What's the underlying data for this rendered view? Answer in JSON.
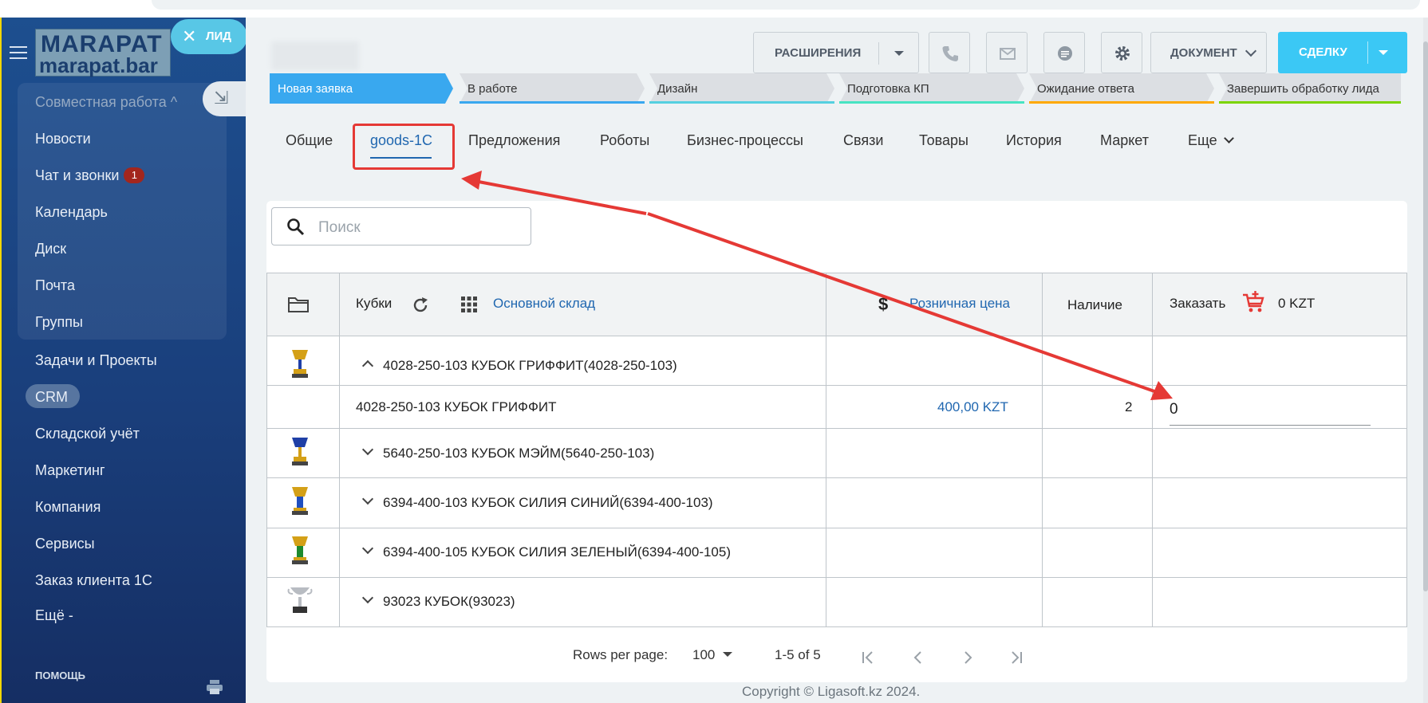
{
  "sidebar": {
    "logo_line1": "MARAPAT",
    "logo_line2": "marapat.bar",
    "lead_button": "ЛИД",
    "group_header": "Совместная работа ^",
    "items": [
      "Новости",
      "Чат и звонки",
      "Календарь",
      "Диск",
      "Почта",
      "Группы",
      "Задачи и Проекты",
      "CRM",
      "Складской учёт",
      "Маркетинг",
      "Компания",
      "Сервисы",
      "Заказ клиента 1С",
      "Ещё -"
    ],
    "chat_badge": "1",
    "help": "ПОМОЩЬ"
  },
  "toolbar": {
    "extensions_label": "РАСШИРЕНИЯ",
    "document_label": "ДОКУМЕНТ",
    "deal_label": "СДЕЛКУ"
  },
  "stages": [
    {
      "label": "Новая заявка",
      "color": "#2fc6f6",
      "active": true
    },
    {
      "label": "В работе",
      "color": "#39a8ef",
      "active": false
    },
    {
      "label": "Дизайн",
      "color": "#55d0e0",
      "active": false
    },
    {
      "label": "Подготовка КП",
      "color": "#47e4c2",
      "active": false
    },
    {
      "label": "Ожидание ответа",
      "color": "#ffa900",
      "active": false
    },
    {
      "label": "Завершить обработку лида",
      "color": "#7bd500",
      "active": false
    }
  ],
  "tabs": [
    "Общие",
    "goods-1C",
    "Предложения",
    "Роботы",
    "Бизнес-процессы",
    "Связи",
    "Товары",
    "История",
    "Маркет",
    "Еще"
  ],
  "search": {
    "placeholder": "Поиск"
  },
  "table": {
    "category": "Кубки",
    "warehouse": "Основной склад",
    "price_header": "Розничная цена",
    "stock_header": "Наличие",
    "order_header": "Заказать",
    "order_total": "0 KZT",
    "rows": [
      {
        "title": "4028-250-103 КУБОК ГРИФФИТ(4028-250-103)",
        "expanded": true,
        "cup_color": "#d4a017"
      },
      {
        "title": "5640-250-103 КУБОК МЭЙМ(5640-250-103)",
        "expanded": false,
        "cup_color": "#1f3fa6"
      },
      {
        "title": "6394-400-103 КУБОК СИЛИЯ СИНИЙ(6394-400-103)",
        "expanded": false,
        "cup_color": "#1f4fc0"
      },
      {
        "title": "6394-400-105 КУБОК СИЛИЯ ЗЕЛЕНЫЙ(6394-400-105)",
        "expanded": false,
        "cup_color": "#1e8a2e"
      },
      {
        "title": "93023 КУБОК(93023)",
        "expanded": false,
        "cup_color": "#b8bcc2"
      }
    ],
    "detail": {
      "name": "4028-250-103 КУБОК ГРИФФИТ",
      "price": "400,00 KZT",
      "stock": "2",
      "order_qty": "0"
    }
  },
  "pagination": {
    "rows_per_page_label": "Rows per page:",
    "rows_per_page": "100",
    "range": "1-5 of 5"
  },
  "footer": {
    "copyright": "Copyright © Ligasoft.kz 2024."
  },
  "colors": {
    "accent": "#2067b0",
    "annotation": "#e53935",
    "deal_button": "#3bc8f5"
  }
}
